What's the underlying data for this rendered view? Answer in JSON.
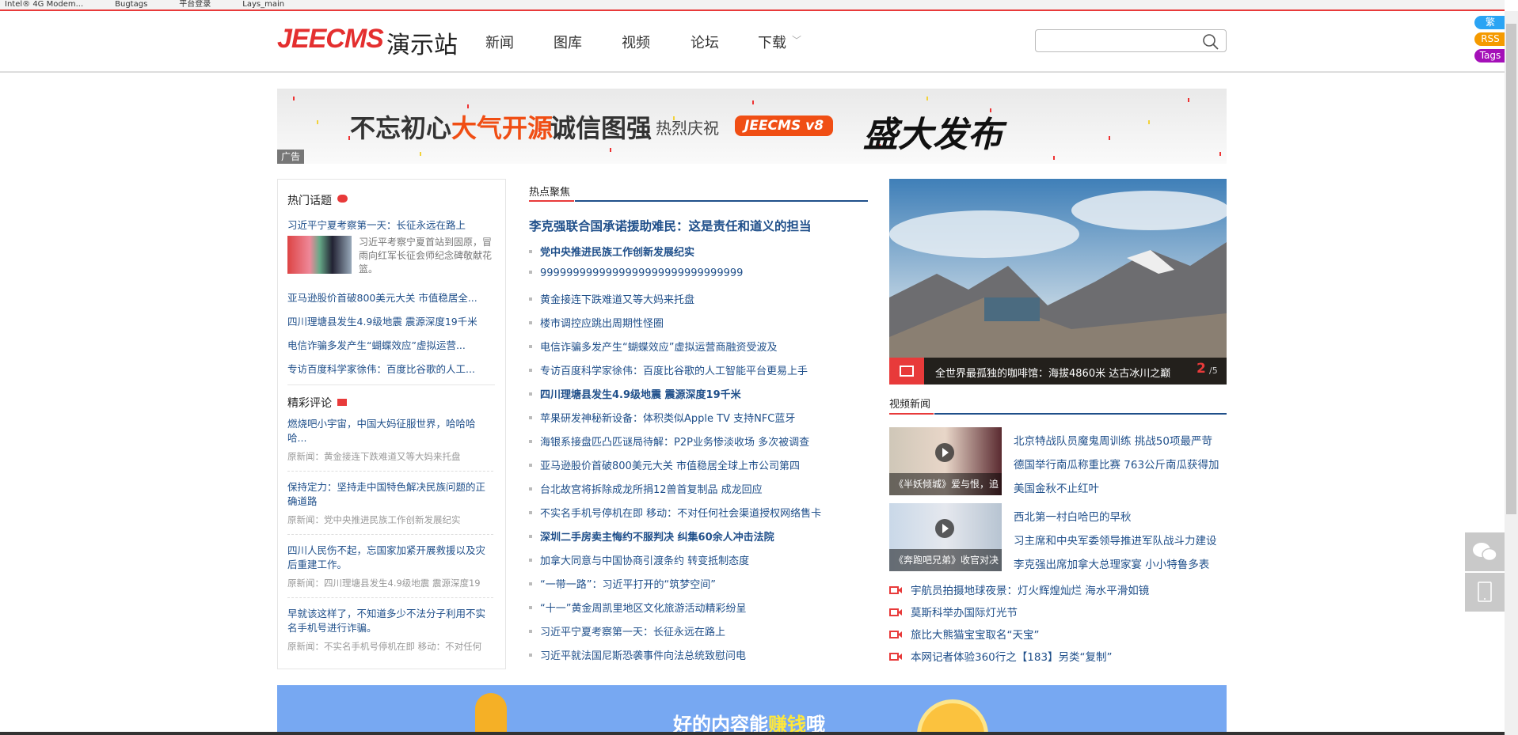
{
  "bookmarks": [
    "Intel® 4G Modem...",
    "Bugtags",
    "平台登录",
    "Lays_main"
  ],
  "header": {
    "logo_en": "JEECMS",
    "logo_cn": "演示站",
    "nav": [
      "新闻",
      "图库",
      "视频",
      "论坛",
      "下载"
    ],
    "search_placeholder": ""
  },
  "side_badges": [
    "繁",
    "RSS",
    "Tags"
  ],
  "banner": {
    "ad_label": "广告",
    "t1": "不忘初心",
    "t2": "大气开源",
    "t3": "诚信图强",
    "t4": "热烈庆祝",
    "t5": "JEECMS v8",
    "t6": "盛大发布"
  },
  "hot_topics": {
    "title": "热门话题",
    "headline": "习近平宁夏考察第一天：长征永远在路上",
    "summary": "习近平考察宁夏首站到固原，冒雨向红军长征会师纪念碑敬献花篮。",
    "items": [
      "亚马逊股价首破800美元大关 市值稳居全...",
      "四川理塘县发生4.9级地震 震源深度19千米",
      "电信诈骗多发产生“蝴蝶效应”虚拟运营...",
      "专访百度科学家徐伟：百度比谷歌的人工..."
    ]
  },
  "comments": {
    "title": "精彩评论",
    "items": [
      {
        "text": "燃烧吧小宇宙，中国大妈征服世界，哈哈哈哈...",
        "orig": "原新闻：黄金接连下跌难道又等大妈来托盘"
      },
      {
        "text": "保持定力：坚持走中国特色解决民族问题的正确道路",
        "orig": "原新闻：党中央推进民族工作创新发展纪实"
      },
      {
        "text": "四川人民伤不起，忘国家加紧开展救援以及灾后重建工作。",
        "orig": "原新闻：四川理塘县发生4.9级地震 震源深度19"
      },
      {
        "text": "早就该这样了，不知道多少不法分子利用不实名手机号进行诈骗。",
        "orig": "原新闻：不实名手机号停机在即 移动：不对任何"
      }
    ]
  },
  "focus": {
    "title": "热点聚焦",
    "headline": "李克强联合国承诺援助难民：这是责任和道义的担当",
    "items": [
      {
        "t": "党中央推进民族工作创新发展纪实",
        "b": true
      },
      {
        "t": "9999999999999999999999999999999",
        "b": false
      },
      {
        "t": "黄金接连下跌难道又等大妈来托盘",
        "b": false
      },
      {
        "t": "楼市调控应跳出周期性怪圈",
        "b": false
      },
      {
        "t": "电信诈骗多发产生“蝴蝶效应”虚拟运营商融资受波及",
        "b": false
      },
      {
        "t": "专访百度科学家徐伟：百度比谷歌的人工智能平台更易上手",
        "b": false
      },
      {
        "t": "四川理塘县发生4.9级地震 震源深度19千米",
        "b": true
      },
      {
        "t": "苹果研发神秘新设备：体积类似Apple TV 支持NFC蓝牙",
        "b": false
      },
      {
        "t": "海银系接盘匹凸匹谜局待解：P2P业务惨淡收场 多次被调查",
        "b": false
      },
      {
        "t": "亚马逊股价首破800美元大关 市值稳居全球上市公司第四",
        "b": false
      },
      {
        "t": "台北故宫将拆除成龙所捐12兽首复制品 成龙回应",
        "b": false
      },
      {
        "t": "不实名手机号停机在即 移动：不对任何社会渠道授权网络售卡",
        "b": false
      },
      {
        "t": "深圳二手房卖主悔约不服判决 纠集60余人冲击法院",
        "b": true
      },
      {
        "t": "加拿大同意与中国协商引渡条约 转变抵制态度",
        "b": false
      },
      {
        "t": "“一带一路”：习近平打开的“筑梦空间”",
        "b": false
      },
      {
        "t": "“十一”黄金周凯里地区文化旅游活动精彩纷呈",
        "b": false
      },
      {
        "t": "习近平宁夏考察第一天：长征永远在路上",
        "b": false
      },
      {
        "t": "习近平就法国尼斯恐袭事件向法总统致慰问电",
        "b": false
      }
    ]
  },
  "carousel": {
    "caption": "全世界最孤独的咖啡馆：海拔4860米 达古冰川之巅",
    "current": "2",
    "total": "/5"
  },
  "video": {
    "title": "视频新闻",
    "blocks": [
      {
        "thumb": "《半妖倾城》爱与恨，追",
        "links": [
          "北京特战队员魔鬼周训练 挑战50项最严苛",
          "德国举行南瓜称重比赛 763公斤南瓜获得加",
          "美国金秋不止红叶"
        ]
      },
      {
        "thumb": "《奔跑吧兄弟》收官对决",
        "links": [
          "西北第一村白哈巴的早秋",
          "习主席和中央军委领导推进军队战斗力建设",
          "李克强出席加拿大总理家宴 小小特鲁多表"
        ]
      }
    ],
    "list": [
      "宇航员拍摄地球夜景：灯火辉煌灿烂 海水平滑如镜",
      "莫斯科举办国际灯光节",
      "旅比大熊猫宝宝取名“天宝”",
      "本网记者体验360行之【183】另类“复制”"
    ]
  },
  "bottom_banner": {
    "text1": "好的内容能",
    "text2": "赚钱",
    "text3": "哦"
  },
  "colors": {
    "accent": "#e83a3a",
    "link": "#1f4f8a"
  }
}
